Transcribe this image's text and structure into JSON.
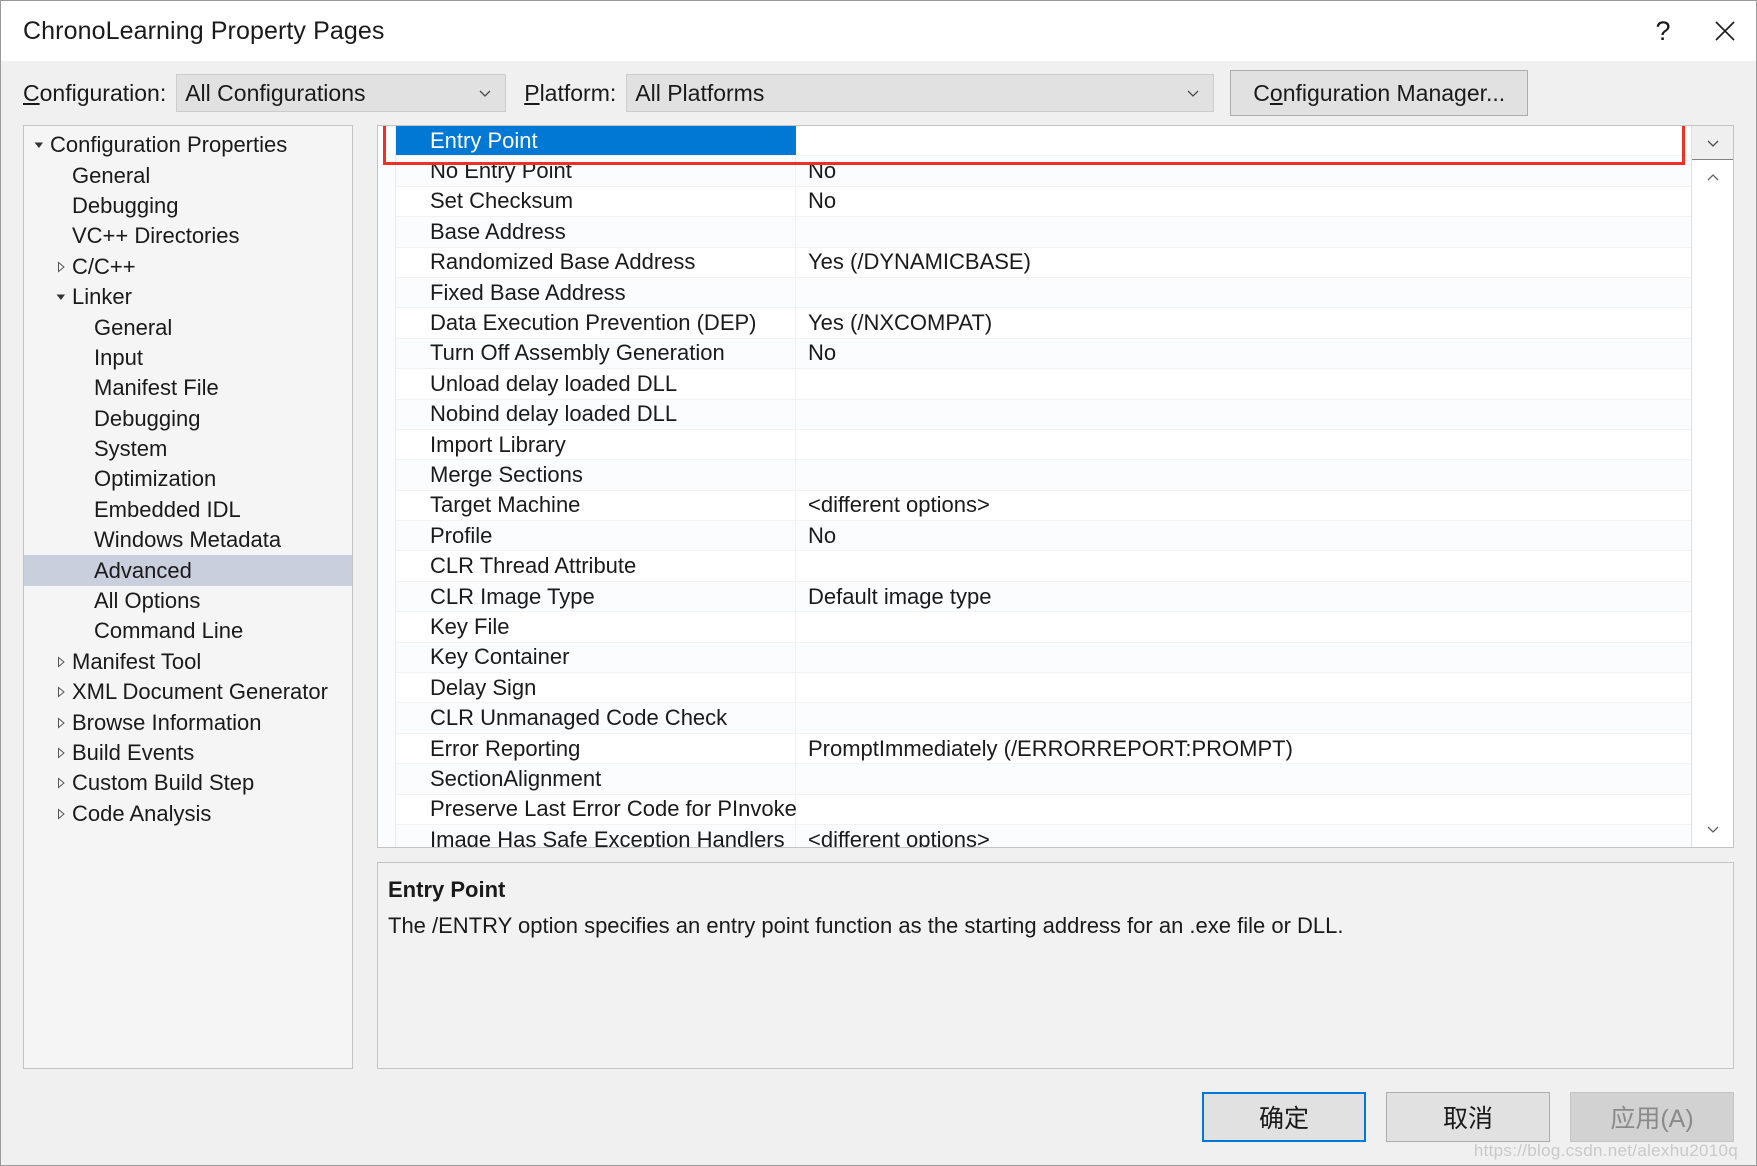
{
  "window": {
    "title": "ChronoLearning Property Pages",
    "help_icon": "?",
    "close_icon": "close-icon"
  },
  "toolbar": {
    "configuration_label": "Configuration:",
    "configuration_value": "All Configurations",
    "platform_label": "Platform:",
    "platform_value": "All Platforms",
    "configuration_manager_label": "Configuration Manager..."
  },
  "tree": {
    "items": [
      {
        "label": "Configuration Properties",
        "depth": 0,
        "twisty": "expanded",
        "selected": false
      },
      {
        "label": "General",
        "depth": 1,
        "twisty": "none",
        "selected": false
      },
      {
        "label": "Debugging",
        "depth": 1,
        "twisty": "none",
        "selected": false
      },
      {
        "label": "VC++ Directories",
        "depth": 1,
        "twisty": "none",
        "selected": false
      },
      {
        "label": "C/C++",
        "depth": 1,
        "twisty": "collapsed",
        "selected": false
      },
      {
        "label": "Linker",
        "depth": 1,
        "twisty": "expanded",
        "selected": false
      },
      {
        "label": "General",
        "depth": 2,
        "twisty": "none",
        "selected": false
      },
      {
        "label": "Input",
        "depth": 2,
        "twisty": "none",
        "selected": false
      },
      {
        "label": "Manifest File",
        "depth": 2,
        "twisty": "none",
        "selected": false
      },
      {
        "label": "Debugging",
        "depth": 2,
        "twisty": "none",
        "selected": false
      },
      {
        "label": "System",
        "depth": 2,
        "twisty": "none",
        "selected": false
      },
      {
        "label": "Optimization",
        "depth": 2,
        "twisty": "none",
        "selected": false
      },
      {
        "label": "Embedded IDL",
        "depth": 2,
        "twisty": "none",
        "selected": false
      },
      {
        "label": "Windows Metadata",
        "depth": 2,
        "twisty": "none",
        "selected": false
      },
      {
        "label": "Advanced",
        "depth": 2,
        "twisty": "none",
        "selected": true
      },
      {
        "label": "All Options",
        "depth": 2,
        "twisty": "none",
        "selected": false
      },
      {
        "label": "Command Line",
        "depth": 2,
        "twisty": "none",
        "selected": false
      },
      {
        "label": "Manifest Tool",
        "depth": 1,
        "twisty": "collapsed",
        "selected": false
      },
      {
        "label": "XML Document Generator",
        "depth": 1,
        "twisty": "collapsed",
        "selected": false
      },
      {
        "label": "Browse Information",
        "depth": 1,
        "twisty": "collapsed",
        "selected": false
      },
      {
        "label": "Build Events",
        "depth": 1,
        "twisty": "collapsed",
        "selected": false
      },
      {
        "label": "Custom Build Step",
        "depth": 1,
        "twisty": "collapsed",
        "selected": false
      },
      {
        "label": "Code Analysis",
        "depth": 1,
        "twisty": "collapsed",
        "selected": false
      }
    ]
  },
  "property_grid": {
    "selected_index": 0,
    "rows": [
      {
        "name": "Entry Point",
        "value": ""
      },
      {
        "name": "No Entry Point",
        "value": "No"
      },
      {
        "name": "Set Checksum",
        "value": "No"
      },
      {
        "name": "Base Address",
        "value": ""
      },
      {
        "name": "Randomized Base Address",
        "value": "Yes (/DYNAMICBASE)"
      },
      {
        "name": "Fixed Base Address",
        "value": ""
      },
      {
        "name": "Data Execution Prevention (DEP)",
        "value": "Yes (/NXCOMPAT)"
      },
      {
        "name": "Turn Off Assembly Generation",
        "value": "No"
      },
      {
        "name": "Unload delay loaded DLL",
        "value": ""
      },
      {
        "name": "Nobind delay loaded DLL",
        "value": ""
      },
      {
        "name": "Import Library",
        "value": ""
      },
      {
        "name": "Merge Sections",
        "value": ""
      },
      {
        "name": "Target Machine",
        "value": "<different options>"
      },
      {
        "name": "Profile",
        "value": "No"
      },
      {
        "name": "CLR Thread Attribute",
        "value": ""
      },
      {
        "name": "CLR Image Type",
        "value": "Default image type"
      },
      {
        "name": "Key File",
        "value": ""
      },
      {
        "name": "Key Container",
        "value": ""
      },
      {
        "name": "Delay Sign",
        "value": ""
      },
      {
        "name": "CLR Unmanaged Code Check",
        "value": ""
      },
      {
        "name": "Error Reporting",
        "value": "PromptImmediately (/ERRORREPORT:PROMPT)"
      },
      {
        "name": "SectionAlignment",
        "value": ""
      },
      {
        "name": "Preserve Last Error Code for PInvoke",
        "value": ""
      },
      {
        "name": "Image Has Safe Exception Handlers",
        "value": "<different options>"
      }
    ]
  },
  "description": {
    "title": "Entry Point",
    "text": "The /ENTRY option specifies an entry point function as the starting address for an .exe file or DLL."
  },
  "footer": {
    "ok_label": "确定",
    "cancel_label": "取消",
    "apply_label": "应用(A)",
    "watermark": "https://blog.csdn.net/alexhu2010q"
  },
  "colors": {
    "selection_blue": "#0078d4",
    "tree_selection": "#c9cfdc",
    "annotation_red": "#ee3124",
    "focus_blue": "#0078d7"
  }
}
